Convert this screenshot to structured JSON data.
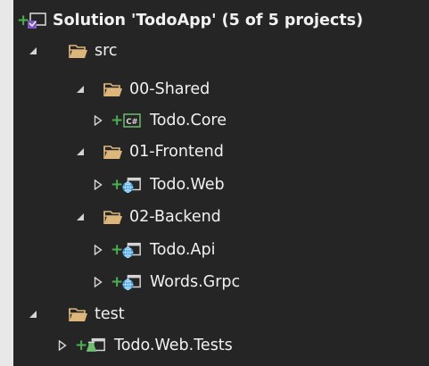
{
  "solution_explorer": {
    "solution": {
      "label": "Solution 'TodoApp' (5 of 5 projects)",
      "icon": "visual-studio-solution-icon"
    },
    "folders": {
      "src": {
        "label": "src",
        "state": "expanded",
        "icon": "folder-open-icon"
      },
      "shared": {
        "label": "00-Shared",
        "state": "expanded",
        "icon": "folder-open-icon"
      },
      "frontend": {
        "label": "01-Frontend",
        "state": "expanded",
        "icon": "folder-open-icon"
      },
      "backend": {
        "label": "02-Backend",
        "state": "expanded",
        "icon": "folder-open-icon"
      },
      "test": {
        "label": "test",
        "state": "expanded",
        "icon": "folder-open-icon"
      }
    },
    "projects": {
      "core": {
        "label": "Todo.Core",
        "icon": "csharp-project-icon",
        "state": "collapsed"
      },
      "web": {
        "label": "Todo.Web",
        "icon": "web-project-icon",
        "state": "collapsed"
      },
      "api": {
        "label": "Todo.Api",
        "icon": "web-project-icon",
        "state": "collapsed"
      },
      "grpc": {
        "label": "Words.Grpc",
        "icon": "web-project-icon",
        "state": "collapsed"
      },
      "tests": {
        "label": "Todo.Web.Tests",
        "icon": "test-project-icon",
        "state": "collapsed"
      }
    },
    "colors": {
      "background": "#252526",
      "text": "#f1f1f1",
      "folder": "#dcb67a",
      "added_marker": "#4caf50",
      "csharp": "#68b26a",
      "web": "#3f9bd8",
      "test": "#6fbf73"
    }
  }
}
